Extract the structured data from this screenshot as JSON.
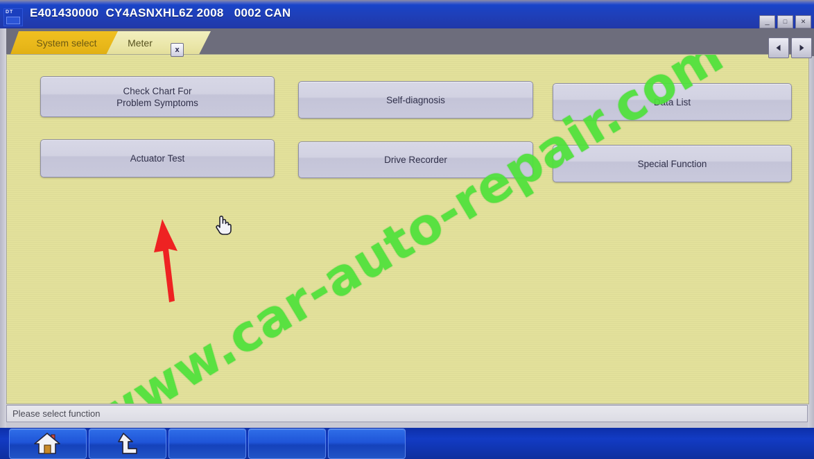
{
  "window": {
    "title": "E401430000  CY4ASNXHL6Z 2008   0002 CAN",
    "app_icon_label": "DT",
    "controls": {
      "minimize": "_",
      "maximize": "□",
      "close": "✕"
    }
  },
  "tabs": [
    {
      "label": "System select",
      "active": false,
      "closable": false
    },
    {
      "label": "Meter",
      "active": true,
      "closable": true,
      "close_label": "x"
    }
  ],
  "tab_nav": {
    "prev_label": "◀",
    "next_label": "▶"
  },
  "main": {
    "buttons": [
      {
        "id": "check-chart-for-problem-symptoms",
        "line1": "Check Chart For",
        "line2": "Problem Symptoms"
      },
      {
        "id": "self-diagnosis",
        "line1": "Self-diagnosis",
        "line2": ""
      },
      {
        "id": "data-list",
        "line1": "Data List",
        "line2": ""
      },
      {
        "id": "actuator-test",
        "line1": "Actuator Test",
        "line2": ""
      },
      {
        "id": "drive-recorder",
        "line1": "Drive Recorder",
        "line2": ""
      },
      {
        "id": "special-function",
        "line1": "Special Function",
        "line2": ""
      }
    ]
  },
  "watermark": {
    "text": "www.car-auto-repair.com",
    "color": "#4ee23a"
  },
  "annotation": {
    "arrow_color": "#ee2222",
    "target": "Actuator Test"
  },
  "status": {
    "message": "Please select function"
  },
  "toolbar": {
    "buttons": [
      {
        "id": "home",
        "icon": "home-icon",
        "label": ""
      },
      {
        "id": "up-level",
        "icon": "arrow-up-level-icon",
        "label": ""
      },
      {
        "id": "blank-1",
        "icon": "",
        "label": ""
      },
      {
        "id": "blank-2",
        "icon": "",
        "label": ""
      },
      {
        "id": "blank-3",
        "icon": "",
        "label": ""
      }
    ]
  },
  "colors": {
    "titlebar": "#1944c8",
    "content_bg": "#e3e19b",
    "button_face": "#d2d2e2",
    "tab_active": "#eae6a8",
    "tab_inactive": "#e8b71a",
    "toolbar": "#123bc4"
  }
}
